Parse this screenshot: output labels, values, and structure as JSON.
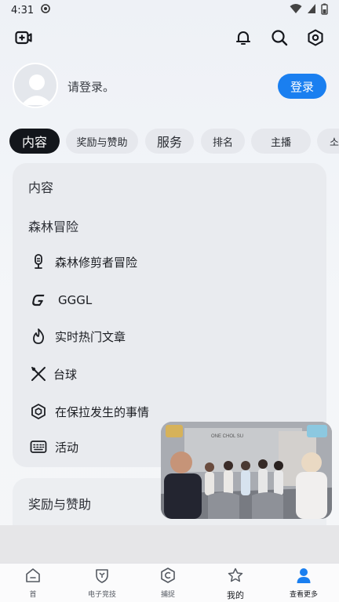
{
  "status_bar": {
    "time": "4:31"
  },
  "profile": {
    "login_hint": "请登录。",
    "login_button": "登录"
  },
  "tabs": [
    {
      "label": "内容"
    },
    {
      "label": "奖励与赞助"
    },
    {
      "label": "服务"
    },
    {
      "label": "排名"
    },
    {
      "label": "主播"
    },
    {
      "label": "소"
    }
  ],
  "content_card": {
    "title": "内容",
    "group_title": "森林冒险",
    "items": [
      {
        "label": "森林修剪者冒险",
        "icon": "microphone-icon"
      },
      {
        "label": "GGGL",
        "icon": "g-logo-icon"
      },
      {
        "label": "实时热门文章",
        "icon": "flame-icon"
      },
      {
        "label": "台球",
        "icon": "cue-crossed-icon"
      },
      {
        "label": "在保拉发生的事情",
        "icon": "hexagon-gear-icon"
      },
      {
        "label": "活动",
        "icon": "keyboard-icon"
      }
    ]
  },
  "rewards_card": {
    "title": "奖励与赞助"
  },
  "video": {
    "caption": "ONE CHOL SU"
  },
  "bottom_nav": [
    {
      "label": "首",
      "icon": "home-icon"
    },
    {
      "label": "电子竞技",
      "icon": "trophy-shield-icon"
    },
    {
      "label": "捕捉",
      "icon": "clip-icon"
    },
    {
      "label": "我的",
      "icon": "star-icon"
    },
    {
      "label": "查看更多",
      "icon": "person-icon"
    }
  ],
  "colors": {
    "accent": "#1a7ff0",
    "active_tab": "#13161b"
  }
}
